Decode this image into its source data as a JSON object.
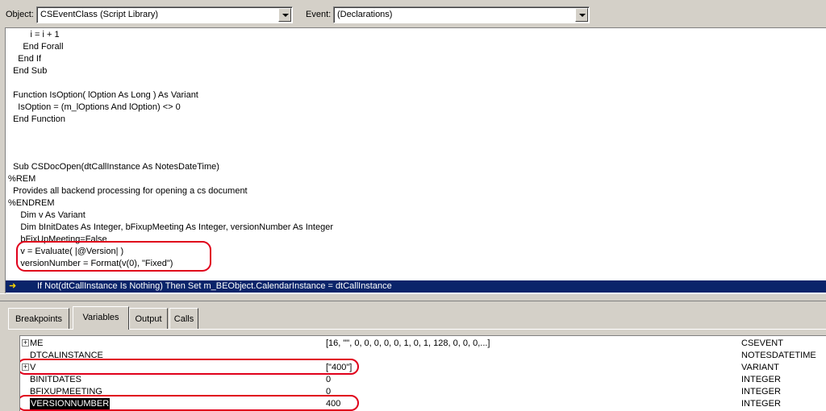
{
  "toolbar": {
    "object_label": "Object:",
    "object_value": "CSEventClass (Script Library)",
    "event_label": "Event:",
    "event_value": "(Declarations)"
  },
  "code_lines": [
    "          i = i + 1",
    "       End Forall",
    "     End If",
    "   End Sub",
    "",
    "   Function IsOption( lOption As Long ) As Variant",
    "     IsOption = (m_lOptions And lOption) <> 0",
    "   End Function",
    "",
    "",
    "",
    "",
    "   Sub CSDocOpen(dtCallInstance As NotesDateTime)",
    " %REM",
    "   Provides all backend processing for opening a cs document",
    " %ENDREM",
    "      Dim v As Variant",
    "      Dim bInitDates As Integer, bFixupMeeting As Integer, versionNumber As Integer",
    "      bFixUpMeeting=False",
    "      v = Evaluate( |@Version| )",
    "      versionNumber = Format(v(0), \"Fixed\")"
  ],
  "current_line": "If Not(dtCallInstance Is Nothing) Then Set m_BEObject.CalendarInstance = dtCallInstance",
  "tabs": [
    "Breakpoints",
    "Variables",
    "Output",
    "Calls"
  ],
  "active_tab": "Variables",
  "variables": [
    {
      "name": "ME",
      "value": "[16, \"\", 0, 0, 0, 0, 0, 1, 0, 1, 128, 0, 0, 0,...]",
      "type": "CSEVENT",
      "expandable": true
    },
    {
      "name": "DTCALINSTANCE",
      "value": "",
      "type": "NOTESDATETIME",
      "expandable": false
    },
    {
      "name": "V",
      "value": "[\"400\"]",
      "type": "VARIANT",
      "expandable": true
    },
    {
      "name": "BINITDATES",
      "value": "0",
      "type": "INTEGER",
      "expandable": false
    },
    {
      "name": "BFIXUPMEETING",
      "value": "0",
      "type": "INTEGER",
      "expandable": false
    },
    {
      "name": "VERSIONNUMBER",
      "value": "400",
      "type": "INTEGER",
      "expandable": false,
      "selected": true
    }
  ],
  "colors": {
    "exec_highlight": "#0a246a",
    "annotation_red": "#e0001b"
  }
}
